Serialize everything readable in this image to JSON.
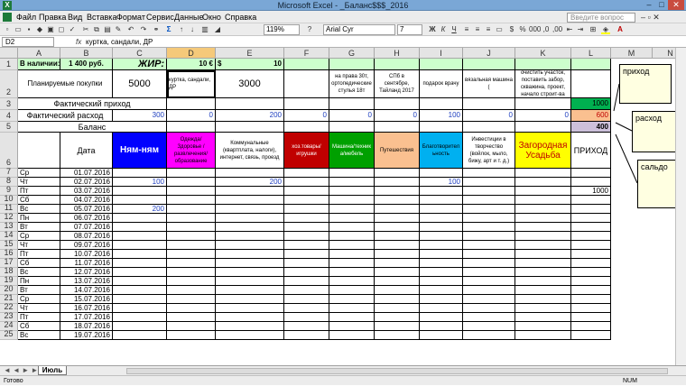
{
  "window": {
    "title": "Microsoft Excel - _Баланс$$$_2016"
  },
  "menu": [
    "Файл",
    "Правка",
    "Вид",
    "Вставка",
    "Формат",
    "Сервис",
    "Данные",
    "Окно",
    "Справка"
  ],
  "ask_placeholder": "Введите вопрос",
  "toolbar": {
    "zoom": "119%",
    "font": "Arial Cyr",
    "size": "7"
  },
  "formula_bar": {
    "cell": "D2",
    "fx": "fx",
    "value": "куртка, сандали, ДР"
  },
  "columns": [
    "A",
    "B",
    "C",
    "D",
    "E",
    "F",
    "G",
    "H",
    "I",
    "J",
    "K",
    "L",
    "M",
    "N"
  ],
  "selected_column": "D",
  "row_numbers": [
    "1",
    "2",
    "3",
    "4",
    "5",
    "6",
    "7",
    "8",
    "9",
    "10",
    "11",
    "12",
    "13",
    "14",
    "15",
    "16",
    "17",
    "18",
    "19",
    "20",
    "21",
    "22",
    "23",
    "24",
    "25"
  ],
  "top": {
    "b1_label": "В наличии:",
    "b1_value": "1 400 руб.",
    "zhir_label": "ЖИР:",
    "zhir_value": "10 €",
    "dollar_sign": "$",
    "dollar_value": "10",
    "planned_label": "Планируемые покупки",
    "c2": "5000",
    "d2": "куртка, сандали, ДР",
    "e2": "3000",
    "g2": "на права 30т, ортопедические стулья 18т",
    "h2": "СПб в сентябре, Тайланд 2017",
    "i2": "подарок врачу",
    "j2": "вязальная машина (",
    "k2": "очистить участок, поставить забор, скважина, проект, начало строит-ва",
    "actual_income_label": "Фактический приход",
    "l3": "1000",
    "actual_expense_label": "Фактический расход",
    "c4": "300",
    "d4": "0",
    "e4": "200",
    "f4": "0",
    "g4": "0",
    "h4": "0",
    "i4": "100",
    "j4": "0",
    "k4": "0",
    "l4": "600",
    "balance_label": "Баланс",
    "l5": "400"
  },
  "headers": {
    "date": "Дата",
    "c6": "Ням-ням",
    "d6": "Одежда/Здоровье /развлечения/ образование",
    "e6": "Коммунальные (квартплата, налоги), интернет, связь, проезд",
    "f6": "хоз.товары/ игрушки",
    "g6": "Машина/техник а/мебель",
    "h6": "Путешествия",
    "i6": "Благотворител ьность",
    "j6": "Инвестиции в творчество (войлок, мыло, бижу, арт и т. д.)",
    "k6": "Загородная Усадьба",
    "l6": "ПРИХОД"
  },
  "header_colors": {
    "c6": "#0000ff",
    "d6": "#ff00ff",
    "e6": "#ffffff",
    "f6": "#c00000",
    "g6": "#00a000",
    "h6": "#fac090",
    "i6": "#00b0f0",
    "j6": "#ffffff",
    "k6": "#ffff00",
    "l6": "#ffffff"
  },
  "rows": [
    {
      "day": "Ср",
      "date": "01.07.2016"
    },
    {
      "day": "Чт",
      "date": "02.07.2016",
      "c": "100",
      "e": "200",
      "i": "100"
    },
    {
      "day": "Пт",
      "date": "03.07.2016",
      "l": "1000"
    },
    {
      "day": "Сб",
      "date": "04.07.2016"
    },
    {
      "day": "Вс",
      "date": "05.07.2016",
      "c": "200"
    },
    {
      "day": "Пн",
      "date": "06.07.2016"
    },
    {
      "day": "Вт",
      "date": "07.07.2016"
    },
    {
      "day": "Ср",
      "date": "08.07.2016"
    },
    {
      "day": "Чт",
      "date": "09.07.2016"
    },
    {
      "day": "Пт",
      "date": "10.07.2016"
    },
    {
      "day": "Сб",
      "date": "11.07.2016"
    },
    {
      "day": "Вс",
      "date": "12.07.2016"
    },
    {
      "day": "Пн",
      "date": "13.07.2016"
    },
    {
      "day": "Вт",
      "date": "14.07.2016"
    },
    {
      "day": "Ср",
      "date": "15.07.2016"
    },
    {
      "day": "Чт",
      "date": "16.07.2016"
    },
    {
      "day": "Пт",
      "date": "17.07.2016"
    },
    {
      "day": "Сб",
      "date": "18.07.2016"
    },
    {
      "day": "Вс",
      "date": "19.07.2016"
    }
  ],
  "comments": {
    "income": "приход",
    "expense": "расход",
    "balance": "сальдо"
  },
  "sheet_tab": "Июль",
  "status": {
    "ready": "Готово",
    "num": "NUM"
  }
}
